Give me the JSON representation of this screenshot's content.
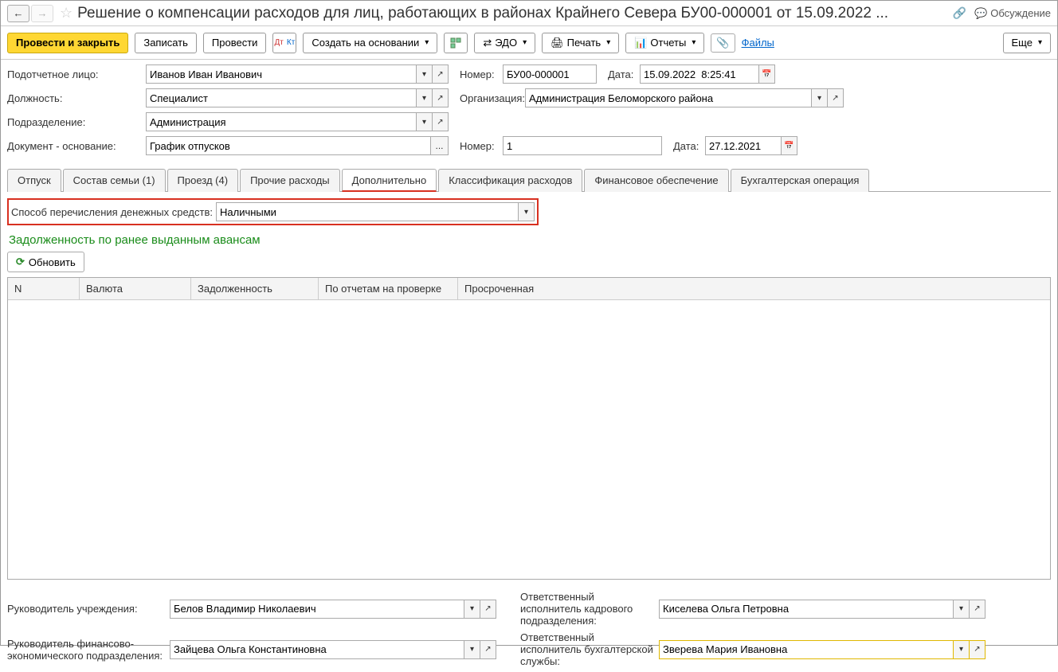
{
  "header": {
    "title": "Решение о компенсации расходов для лиц, работающих в районах Крайнего Севера БУ00-000001 от 15.09.2022 ...",
    "discussion": "Обсуждение"
  },
  "toolbar": {
    "post_close": "Провести и закрыть",
    "save": "Записать",
    "post": "Провести",
    "create_based": "Создать на основании",
    "edo": "ЭДО",
    "print": "Печать",
    "reports": "Отчеты",
    "files": "Файлы",
    "more": "Еще"
  },
  "form": {
    "account_person_label": "Подотчетное лицо:",
    "account_person": "Иванов Иван Иванович",
    "number_label": "Номер:",
    "number": "БУ00-000001",
    "date_label": "Дата:",
    "date": "15.09.2022  8:25:41",
    "position_label": "Должность:",
    "position": "Специалист",
    "org_label": "Организация:",
    "org": "Администрация Беломорского района",
    "division_label": "Подразделение:",
    "division": "Администрация",
    "basis_doc_label": "Документ - основание:",
    "basis_doc": "График отпусков",
    "basis_number_label": "Номер:",
    "basis_number": "1",
    "basis_date_label": "Дата:",
    "basis_date": "27.12.2021"
  },
  "tabs": {
    "vacation": "Отпуск",
    "family": "Состав семьи (1)",
    "travel": "Проезд (4)",
    "other": "Прочие расходы",
    "additional": "Дополнительно",
    "classification": "Классификация расходов",
    "financing": "Финансовое обеспечение",
    "accounting": "Бухгалтерская операция"
  },
  "additional": {
    "method_label": "Способ перечисления денежных средств:",
    "method_value": "Наличными",
    "debt_title": "Задолженность по ранее выданным авансам",
    "refresh": "Обновить"
  },
  "table": {
    "col_n": "N",
    "col_currency": "Валюта",
    "col_debt": "Задолженность",
    "col_reports": "По отчетам на проверке",
    "col_overdue": "Просроченная"
  },
  "footer": {
    "head_label": "Руководитель учреждения:",
    "head_value": "Белов Владимир Николаевич",
    "hr_label": "Ответственный исполнитель кадрового подразделения:",
    "hr_value": "Киселева Ольга Петровна",
    "finance_head_label": "Руководитель финансово-экономического подразделения:",
    "finance_head_value": "Зайцева Ольга Константиновна",
    "acc_label": "Ответственный исполнитель бухгалтерской службы:",
    "acc_value": "Зверева Мария Ивановна"
  }
}
